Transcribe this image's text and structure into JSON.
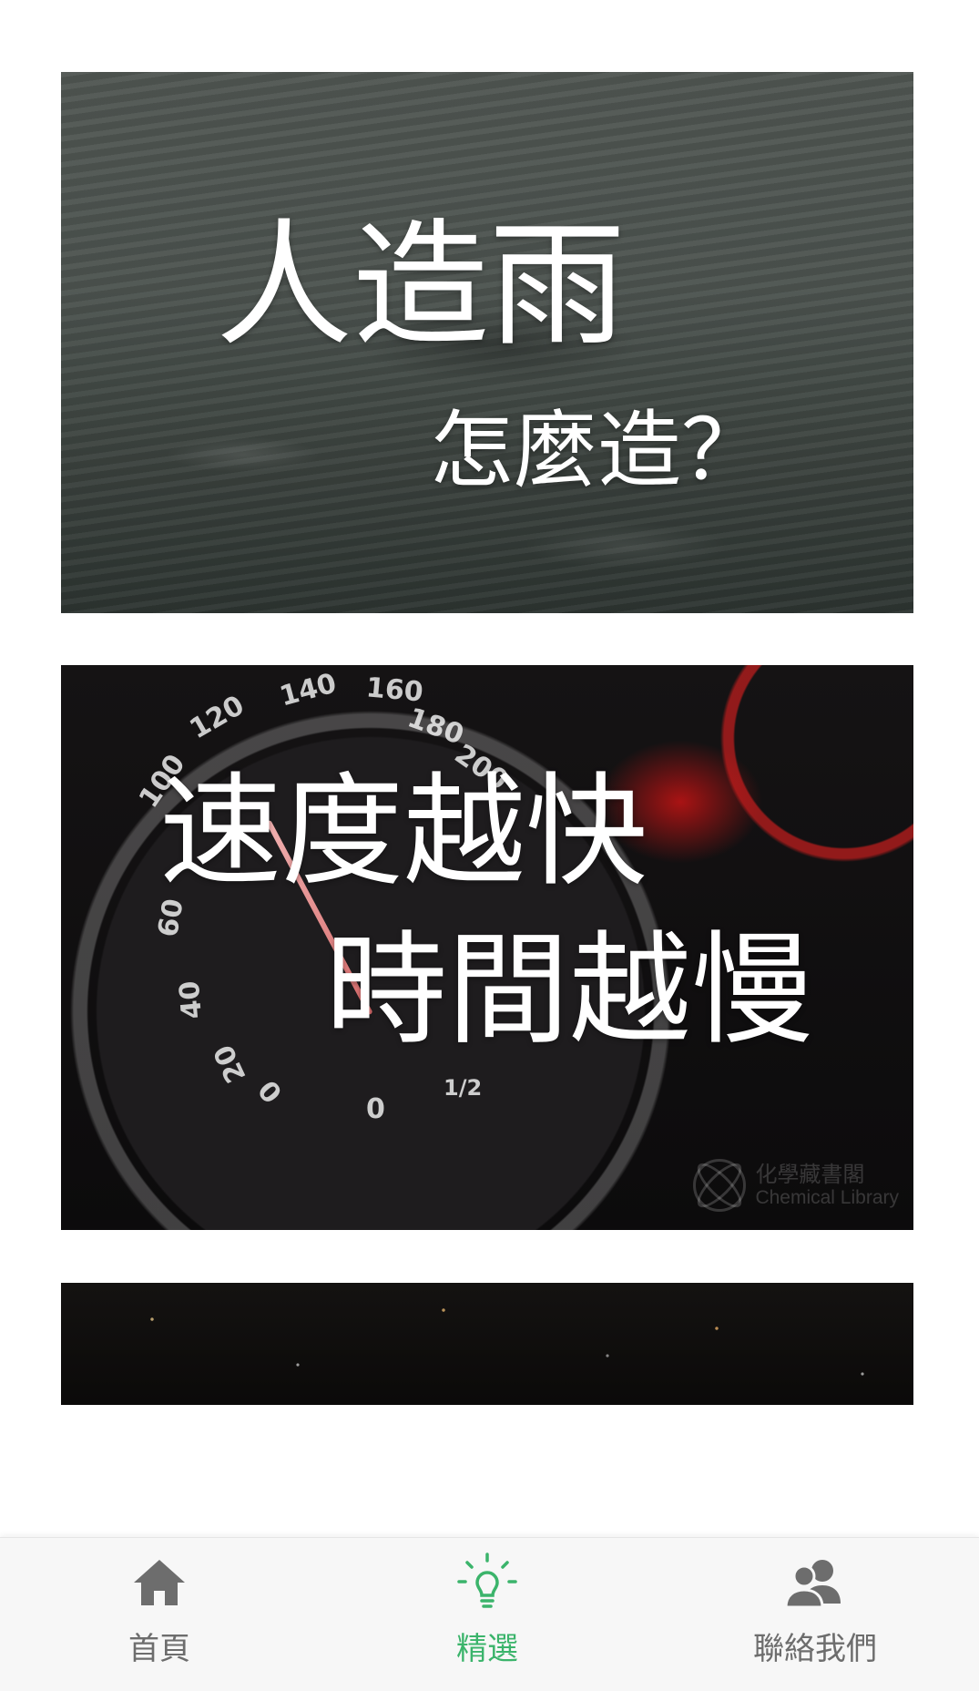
{
  "feed": {
    "cards": [
      {
        "title_line1": "人造雨",
        "title_line2": "怎麼造？"
      },
      {
        "title_line1": "速度越快",
        "title_line2": "時間越慢",
        "watermark_cn": "化學藏書閣",
        "watermark_en": "Chemical Library",
        "gauge_numbers": [
          "120",
          "140",
          "160",
          "180",
          "200",
          "100",
          "60",
          "40",
          "20",
          "0",
          "0",
          "1/2"
        ]
      },
      {}
    ]
  },
  "tabbar": {
    "active_color": "#3bb46b",
    "inactive_color": "#6d6d6d",
    "tabs": [
      {
        "label": "首頁",
        "icon": "home-icon"
      },
      {
        "label": "精選",
        "icon": "lightbulb-icon"
      },
      {
        "label": "聯絡我們",
        "icon": "contacts-icon"
      }
    ]
  }
}
